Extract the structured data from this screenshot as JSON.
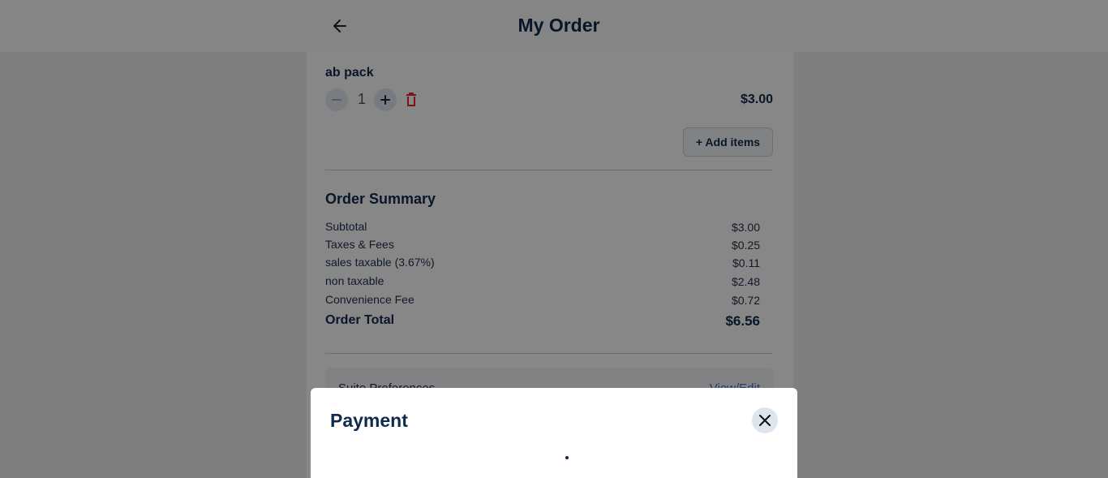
{
  "header": {
    "title": "My Order",
    "back_icon": "arrow-left-icon"
  },
  "item": {
    "name": "ab pack",
    "quantity": "1",
    "price": "$3.00"
  },
  "actions": {
    "add_items_label": "+ Add items"
  },
  "summary": {
    "title": "Order Summary",
    "rows": [
      {
        "label": "Subtotal",
        "value": "$3.00"
      },
      {
        "label": "Taxes & Fees",
        "value": "$0.25"
      },
      {
        "label": "sales taxable (3.67%)",
        "value": "$0.11"
      },
      {
        "label": "non taxable",
        "value": "$2.48"
      },
      {
        "label": "Convenience Fee",
        "value": "$0.72"
      }
    ],
    "total_label": "Order Total",
    "total_value": "$6.56"
  },
  "preferences": {
    "label": "Suite Preferences",
    "link": "View/Edit"
  },
  "modal": {
    "title": "Payment",
    "close_icon": "close-icon"
  },
  "colors": {
    "primary_text": "#0f2a4a",
    "delete": "#e0262c",
    "link": "#3d6fcf"
  }
}
